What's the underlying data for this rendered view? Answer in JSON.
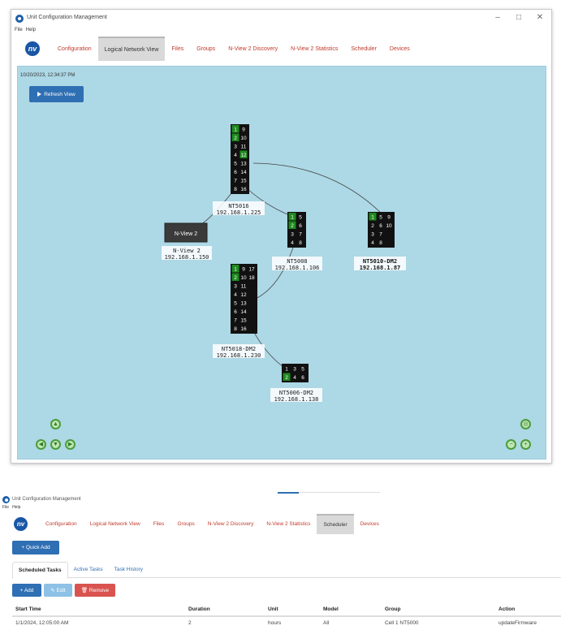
{
  "window1": {
    "title": "Unit Configuration Management",
    "controls": [
      "–",
      "□",
      "✕"
    ],
    "menu": [
      "File",
      "Help"
    ],
    "logo_text": "nv",
    "tabs": [
      {
        "label": "Configuration"
      },
      {
        "label": "Logical Network View",
        "active": true
      },
      {
        "label": "Files"
      },
      {
        "label": "Groups"
      },
      {
        "label": "N-View 2 Discovery"
      },
      {
        "label": "N-View 2 Statistics"
      },
      {
        "label": "Scheduler"
      },
      {
        "label": "Devices"
      }
    ],
    "timestamp": "10/20/2023, 12:34:37 PM",
    "refresh_label": "Refresh View",
    "nodes": {
      "nt5016": {
        "name": "NT5016",
        "ip": "192.168.1.225",
        "ports": [
          [
            "1",
            "9"
          ],
          [
            "2",
            "10"
          ],
          [
            "3",
            "11"
          ],
          [
            "4",
            "12"
          ],
          [
            "5",
            "13"
          ],
          [
            "6",
            "14"
          ],
          [
            "7",
            "15"
          ],
          [
            "8",
            "16"
          ]
        ],
        "active": [
          "1",
          "2",
          "12"
        ]
      },
      "nview2": {
        "label": "N-View 2",
        "name": "N-View 2",
        "ip": "192.168.1.150"
      },
      "nt5008": {
        "name": "NT5008",
        "ip": "192.168.1.106",
        "ports": [
          [
            "1",
            "5"
          ],
          [
            "2",
            "6"
          ],
          [
            "3",
            "7"
          ],
          [
            "4",
            "8"
          ]
        ],
        "active": [
          "1",
          "2"
        ]
      },
      "nt5010": {
        "name": "NT5010-DM2",
        "ip": "192.168.1.87",
        "ports": [
          [
            "1",
            "5",
            "9"
          ],
          [
            "2",
            "6",
            "10"
          ],
          [
            "3",
            "7",
            ""
          ],
          [
            "4",
            "8",
            ""
          ]
        ],
        "active": [
          "1"
        ]
      },
      "nt5018": {
        "name": "NT5018-DM2",
        "ip": "192.168.1.230",
        "ports": [
          [
            "1",
            "9",
            "17"
          ],
          [
            "2",
            "10",
            "18"
          ],
          [
            "3",
            "11",
            ""
          ],
          [
            "4",
            "12",
            ""
          ],
          [
            "5",
            "13",
            ""
          ],
          [
            "6",
            "14",
            ""
          ],
          [
            "7",
            "15",
            ""
          ],
          [
            "8",
            "16",
            ""
          ]
        ],
        "active": [
          "1",
          "2"
        ]
      },
      "nt5006": {
        "name": "NT5006-DM2",
        "ip": "192.168.1.138",
        "ports": [
          [
            "1",
            "3",
            "5"
          ],
          [
            "2",
            "4",
            "6"
          ]
        ],
        "active": [
          "2"
        ]
      }
    },
    "icons": [
      "zoom-up-icon",
      "pan-left-icon",
      "pan-center-icon",
      "pan-right-icon",
      "fit-icon",
      "zoom-out-icon",
      "zoom-in-icon"
    ]
  },
  "window2": {
    "title": "Unit Configuration Management",
    "menu": [
      "File",
      "Help"
    ],
    "logo_text": "nv",
    "tabs": [
      {
        "label": "Configuration"
      },
      {
        "label": "Logical Network View"
      },
      {
        "label": "Files"
      },
      {
        "label": "Groups"
      },
      {
        "label": "N-View 2 Discovery"
      },
      {
        "label": "N-View 2 Statistics"
      },
      {
        "label": "Scheduler",
        "active": true
      },
      {
        "label": "Devices"
      }
    ],
    "quick_add_label": "+ Quick Add",
    "subtabs": [
      {
        "label": "Scheduled Tasks",
        "active": true
      },
      {
        "label": "Active Tasks"
      },
      {
        "label": "Task History"
      }
    ],
    "toolbar": {
      "add": "+ Add",
      "edit": "✎ Edit",
      "remove": "🗑 Remove"
    },
    "table": {
      "columns": [
        "Start Time",
        "Duration",
        "Unit",
        "Model",
        "Group",
        "Action"
      ],
      "rows": [
        [
          "1/1/2024, 12:05:00 AM",
          "2",
          "hours",
          "All",
          "Cell 1 NT5000",
          "updateFirmware"
        ]
      ]
    }
  }
}
